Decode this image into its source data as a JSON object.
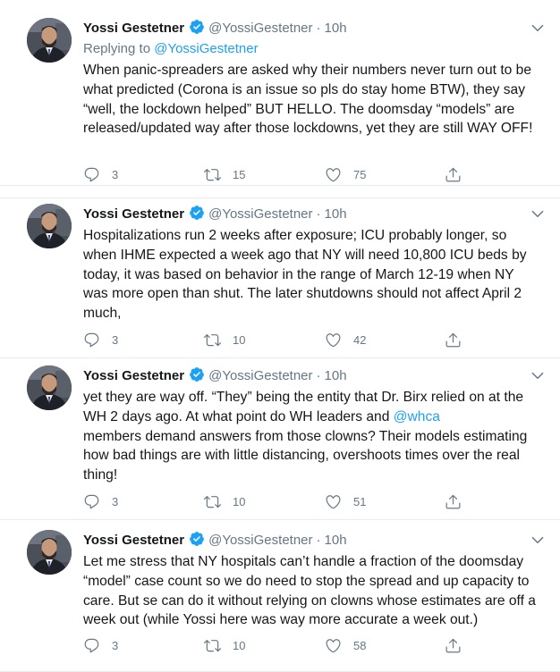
{
  "tweets": [
    {
      "name": "Yossi Gestetner",
      "handle": "@YossiGestetner",
      "dot": "·",
      "time": "10h",
      "replying_prefix": "Replying to ",
      "replying_handle": "@YossiGestetner",
      "text": "When panic-spreaders are asked why their numbers never turn out to be what predicted (Corona is an issue so pls do stay home BTW), they say “well, the lockdown helped” BUT HELLO. The doomsday “models” are released/updated way after those lockdowns, yet they are still WAY OFF!",
      "replies": "3",
      "retweets": "15",
      "likes": "75"
    },
    {
      "name": "Yossi Gestetner",
      "handle": "@YossiGestetner",
      "dot": "·",
      "time": "10h",
      "text": "Hospitalizations run 2 weeks after exposure; ICU probably longer, so when IHME expected a week ago that NY will need 10,800 ICU beds by today, it was based on behavior in the range of March 12-19 when NY was more open than shut. The later shutdowns should not affect April 2 much,",
      "replies": "3",
      "retweets": "10",
      "likes": "42"
    },
    {
      "name": "Yossi Gestetner",
      "handle": "@YossiGestetner",
      "dot": "·",
      "time": "10h",
      "text_before": "yet they are way off. “They” being the entity that Dr. Birx relied on at the WH 2 days ago. At what point do WH leaders and ",
      "mention": "@whca",
      "text_after": " members demand answers from those clowns? Their models estimating how bad things are with little distancing, overshoots times over the real thing!",
      "replies": "3",
      "retweets": "10",
      "likes": "51"
    },
    {
      "name": "Yossi Gestetner",
      "handle": "@YossiGestetner",
      "dot": "·",
      "time": "10h",
      "text": "Let me stress that NY hospitals can’t handle a fraction of the doomsday “model” case count so we do need to stop the spread and up capacity to care. But se can do it without relying on clowns whose estimates are off a week out (while Yossi here was way more accurate a week out.)",
      "replies": "3",
      "retweets": "10",
      "likes": "58"
    }
  ],
  "icons": {
    "reply": "reply-icon",
    "retweet": "retweet-icon",
    "like": "heart-icon",
    "share": "share-icon",
    "verified": "verified-badge-icon",
    "more": "chevron-down-icon"
  },
  "colors": {
    "link": "#1da1f2",
    "muted": "#657786",
    "text": "#14171a",
    "border": "#e6ecf0"
  }
}
